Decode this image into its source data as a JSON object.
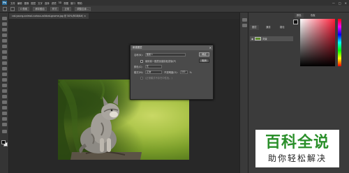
{
  "app": {
    "logo": "Ps",
    "menu_items": [
      "文件",
      "编辑",
      "图像",
      "图层",
      "文字",
      "选择",
      "滤镜",
      "3D",
      "视图",
      "窗口",
      "帮助"
    ],
    "window_controls": [
      "—",
      "□",
      "✕"
    ]
  },
  "options_bar": {
    "chips": [
      "0 像素",
      "消除锯齿",
      "样式",
      "正常",
      "调整边缘..."
    ]
  },
  "document": {
    "tab_label": "cat-young-animal-curious-wildcat-gnome.jpg @ 50%(RGB/8#)",
    "tab_close": "×"
  },
  "panels": {
    "color_tab": "颜色",
    "swatches_tab": "色板",
    "layers_tab": "图层",
    "channels_tab": "通道",
    "paths_tab": "路径"
  },
  "layers": {
    "items": [
      {
        "name": "背景",
        "visible_icon": "eye-icon"
      }
    ]
  },
  "dialog": {
    "title": "新建图层",
    "close": "✕",
    "name_label": "名称(N):",
    "name_value": "图层 1",
    "clip_label": "使用前一图层创建剪贴蒙版(P)",
    "color_label": "颜色(C):",
    "color_value": "无",
    "mode_label": "模式(M):",
    "mode_value": "正常",
    "opacity_label": "不透明度(O):",
    "opacity_value": "100",
    "opacity_unit": "%",
    "neutral_label": "(正常模式不存在中性色。)",
    "ok": "确定",
    "cancel": "取消"
  },
  "watermark": {
    "title": "百科全说",
    "subtitle": "助你轻松解决"
  },
  "colors": {
    "app_bg": "#282828",
    "panel_bg": "#3b3b3b",
    "watermark_green": "#2a8f2a"
  }
}
